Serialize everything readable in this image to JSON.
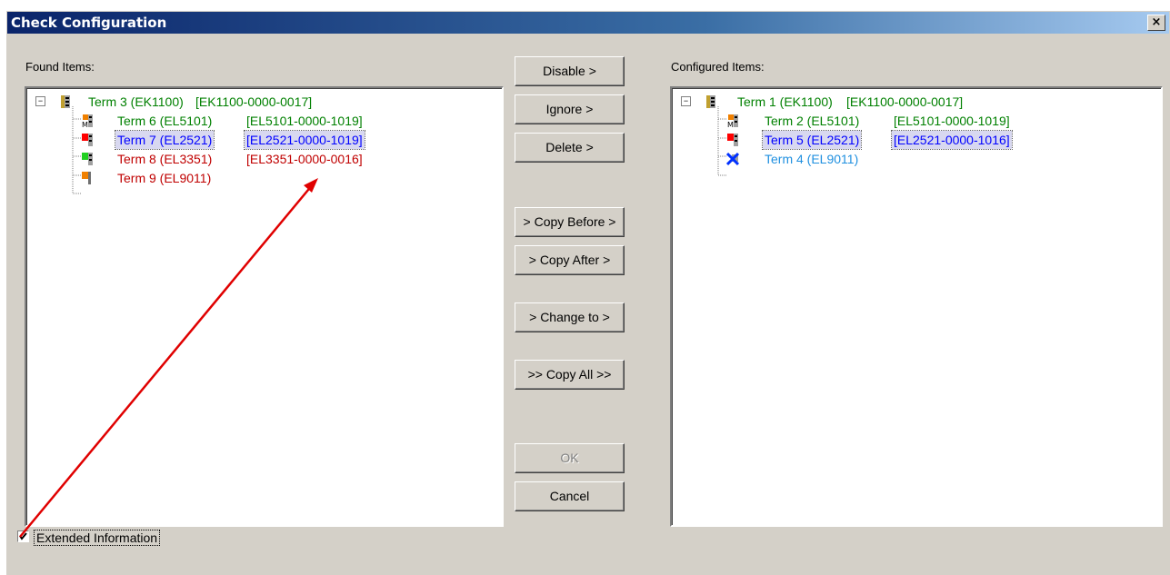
{
  "window": {
    "title": "Check Configuration",
    "close_glyph": "×"
  },
  "found": {
    "label": "Found Items:",
    "items": [
      {
        "name": "Term 3 (EK1100)",
        "detail": "[EK1100-0000-0017]",
        "color": "#008000"
      },
      {
        "name": "Term 6 (EL5101)",
        "detail": "[EL5101-0000-1019]",
        "color": "#008000"
      },
      {
        "name": "Term 7 (EL2521)",
        "detail": "[EL2521-0000-1019]",
        "color": "#0000ff",
        "selected": true
      },
      {
        "name": "Term 8 (EL3351)",
        "detail": "[EL3351-0000-0016]",
        "color": "#c00000"
      },
      {
        "name": "Term 9 (EL9011)",
        "detail": "",
        "color": "#c00000"
      }
    ]
  },
  "configured": {
    "label": "Configured Items:",
    "items": [
      {
        "name": "Term 1 (EK1100)",
        "detail": "[EK1100-0000-0017]",
        "color": "#008000"
      },
      {
        "name": "Term 2 (EL5101)",
        "detail": "[EL5101-0000-1019]",
        "color": "#008000"
      },
      {
        "name": "Term 5 (EL2521)",
        "detail": "[EL2521-0000-1016]",
        "color": "#0000ff",
        "selected": true
      },
      {
        "name": "Term 4 (EL9011)",
        "detail": "",
        "color": "#2090e0"
      }
    ]
  },
  "buttons": {
    "disable": "Disable >",
    "ignore": "Ignore >",
    "delete": "Delete >",
    "copy_before": "> Copy Before >",
    "copy_after": "> Copy After >",
    "change_to": "> Change to >",
    "copy_all": ">> Copy All >>",
    "ok": "OK",
    "cancel": "Cancel"
  },
  "extended_info": {
    "label": "Extended Information",
    "checked": true
  },
  "colors": {
    "annotation_arrow": "#e00000",
    "title_start": "#0a246a",
    "title_end": "#a6caf0"
  }
}
